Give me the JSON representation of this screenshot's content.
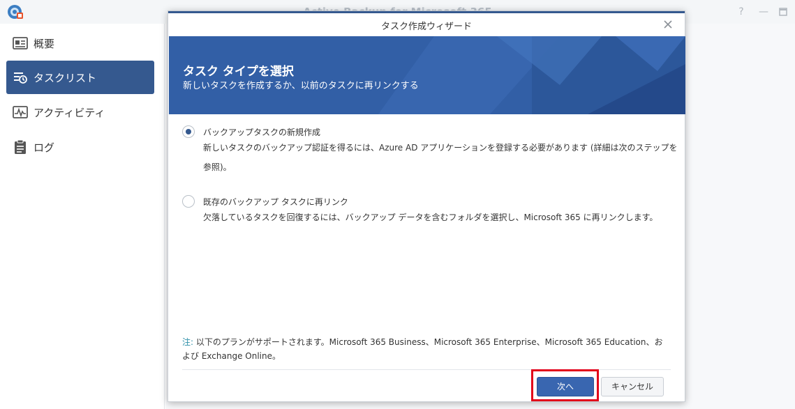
{
  "app": {
    "title": "Active Backup for Microsoft 365",
    "help_icon": "question-icon",
    "minimize_icon": "minimize-icon",
    "maximize_icon": "maximize-icon"
  },
  "sidebar": {
    "items": [
      {
        "label": "概要",
        "icon": "overview-icon",
        "active": false
      },
      {
        "label": "タスクリスト",
        "icon": "task-list-icon",
        "active": true
      },
      {
        "label": "アクティビティ",
        "icon": "activity-icon",
        "active": false
      },
      {
        "label": "ログ",
        "icon": "log-icon",
        "active": false
      }
    ]
  },
  "dialog": {
    "title": "タスク作成ウィザード",
    "banner_title": "タスク タイプを選択",
    "banner_subtitle": "新しいタスクを作成するか、以前のタスクに再リンクする",
    "options": [
      {
        "label": "バックアップタスクの新規作成",
        "description": "新しいタスクのバックアップ認証を得るには、Azure AD アプリケーションを登録する必要があります (詳細は次のステップを参照)。",
        "selected": true
      },
      {
        "label": "既存のバックアップ タスクに再リンク",
        "description": "欠落しているタスクを回復するには、バックアップ データを含むフォルダを選択し、Microsoft 365 に再リンクします。",
        "selected": false
      }
    ],
    "note_label": "注:",
    "note_text": " 以下のプランがサポートされます。Microsoft 365 Business、Microsoft 365 Enterprise、Microsoft 365 Education、および Exchange Online。",
    "next_label": "次へ",
    "cancel_label": "キャンセル"
  },
  "colors": {
    "accent": "#35598f",
    "banner": "#325fa6",
    "primary_button": "#3966b0",
    "highlight": "#e2001a",
    "note_label": "#2d8fa8"
  }
}
